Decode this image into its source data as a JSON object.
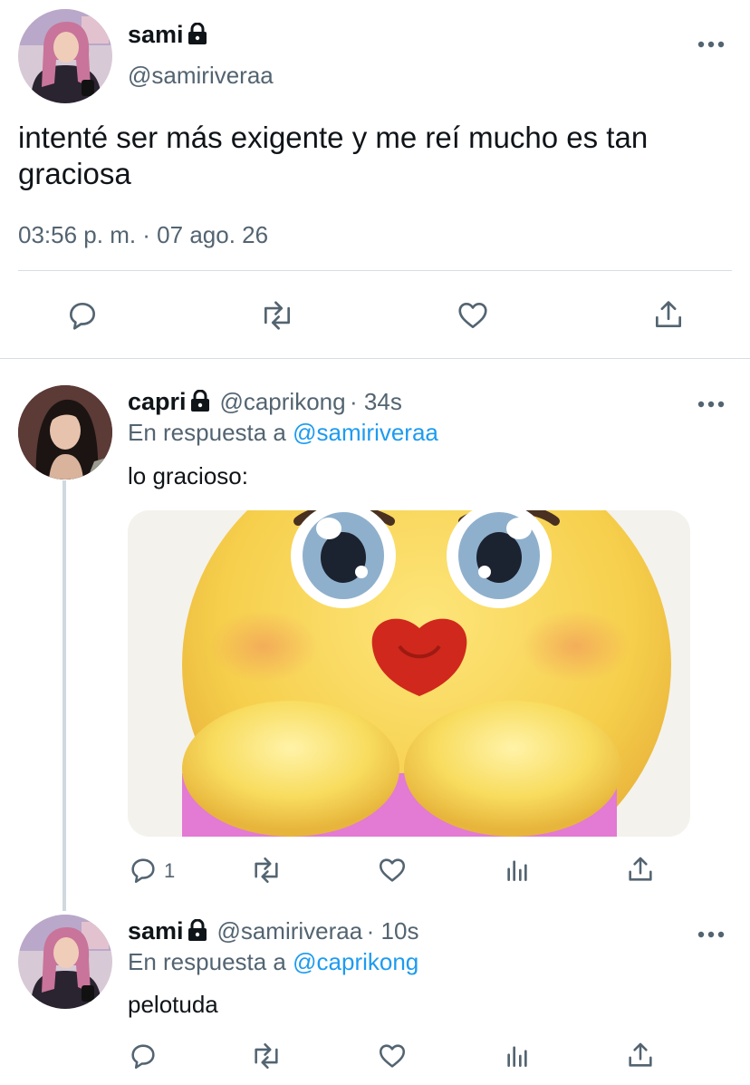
{
  "main_tweet": {
    "display_name": "sami",
    "handle": "@samiriveraa",
    "text": "intenté ser más exigente y me reí mucho es tan graciosa",
    "timestamp": "03:56 p. m. · 07 ago. 26"
  },
  "reply_1": {
    "display_name": "capri",
    "handle": "@caprikong",
    "time": "· 34s",
    "replying_prefix": "En respuesta a",
    "replying_to": "@samiriveraa",
    "text": "lo gracioso:",
    "reply_count": "1"
  },
  "reply_2": {
    "display_name": "sami",
    "handle": "@samiriveraa",
    "time": "· 10s",
    "replying_prefix": "En respuesta a",
    "replying_to": "@caprikong",
    "text": "pelotuda"
  },
  "icons": [
    "lock-icon",
    "more-icon",
    "reply-icon",
    "retweet-icon",
    "like-icon",
    "share-icon",
    "analytics-icon"
  ],
  "colors": {
    "text": "#0f1419",
    "muted": "#536471",
    "link": "#1d9bf0",
    "divider": "#d9dde1"
  }
}
